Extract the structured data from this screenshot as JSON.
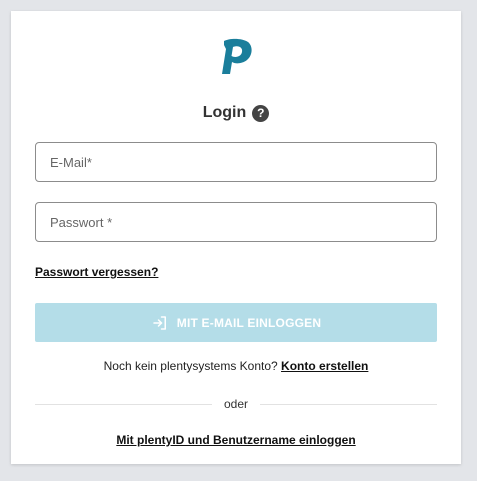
{
  "login": {
    "title": "Login",
    "help_icon": "question-circle-icon",
    "email": {
      "placeholder": "E-Mail*",
      "value": ""
    },
    "password": {
      "placeholder": "Passwort *",
      "value": ""
    },
    "forgot_password": "Passwort vergessen?",
    "submit": {
      "label": "MIT E-MAIL EINLOGGEN",
      "icon": "login-arrow-icon"
    },
    "signup_prompt": "Noch kein plentysystems Konto?",
    "signup_link": "Konto erstellen",
    "divider_text": "oder",
    "plentyid_link": "Mit plentyID und Benutzername einloggen"
  },
  "colors": {
    "background": "#e3e5e9",
    "brand": "#1a7e9b",
    "button_disabled": "#b4dde8"
  }
}
